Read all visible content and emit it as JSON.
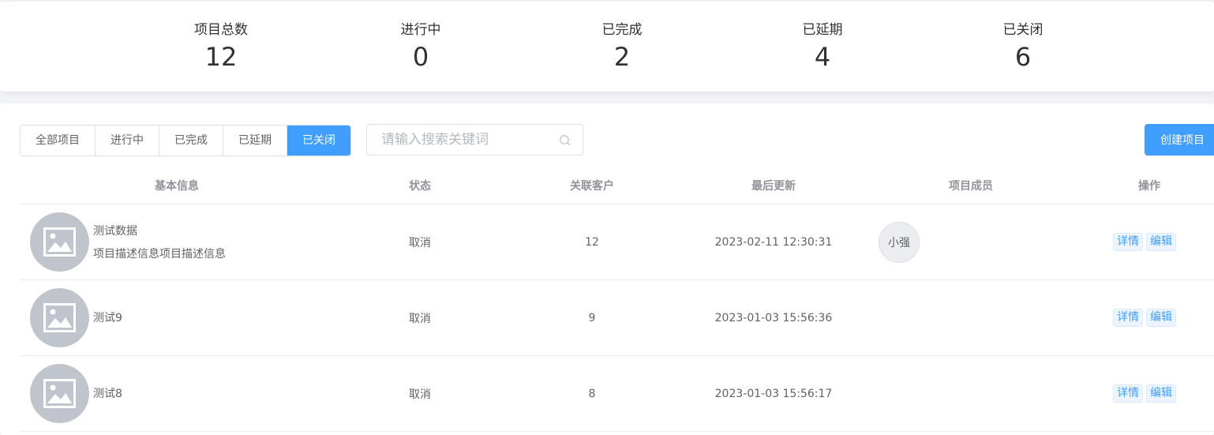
{
  "stats": [
    {
      "label": "项目总数",
      "value": "12"
    },
    {
      "label": "进行中",
      "value": "0"
    },
    {
      "label": "已完成",
      "value": "2"
    },
    {
      "label": "已延期",
      "value": "4"
    },
    {
      "label": "已关闭",
      "value": "6"
    }
  ],
  "tabs": [
    "全部项目",
    "进行中",
    "已完成",
    "已延期",
    "已关闭"
  ],
  "active_tab": "已关闭",
  "search": {
    "placeholder": "请输入搜索关键词",
    "value": ""
  },
  "create_label": "创建项目",
  "columns": [
    "基本信息",
    "状态",
    "关联客户",
    "最后更新",
    "项目成员",
    "操作"
  ],
  "rows": [
    {
      "name": "测试数据",
      "desc": "项目描述信息项目描述信息",
      "status": "取消",
      "customers": "12",
      "updated": "2023-02-11 12:30:31",
      "member": "小强"
    },
    {
      "name": "测试9",
      "desc": "",
      "status": "取消",
      "customers": "9",
      "updated": "2023-01-03 15:56:36",
      "member": ""
    },
    {
      "name": "测试8",
      "desc": "",
      "status": "取消",
      "customers": "8",
      "updated": "2023-01-03 15:56:17",
      "member": ""
    }
  ],
  "ops": {
    "detail": "详情",
    "edit": "编辑"
  },
  "colors": {
    "accent": "#409eff",
    "thumb": "#c0c4cc"
  }
}
